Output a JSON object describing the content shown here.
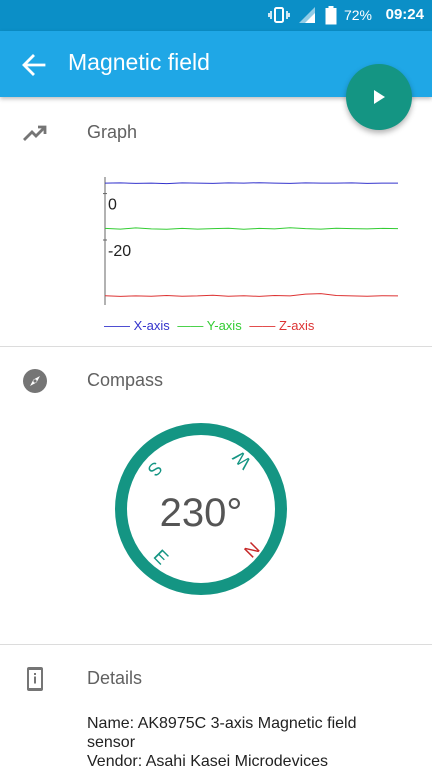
{
  "statusbar": {
    "battery": "72%",
    "time": "09:24"
  },
  "appbar": {
    "title": "Magnetic field"
  },
  "graph": {
    "title": "Graph"
  },
  "compass": {
    "title": "Compass",
    "heading": "230°",
    "labels": {
      "n": "N",
      "e": "E",
      "s": "S",
      "w": "W"
    }
  },
  "details": {
    "title": "Details",
    "name": "Name: AK8975C 3-axis Magnetic field sensor",
    "vendor": "Vendor: Asahi Kasei Microdevices"
  },
  "chart_data": {
    "type": "line",
    "yticks": [
      0,
      -20
    ],
    "ylim": [
      -48,
      8
    ],
    "legend_position": "bottom",
    "series": [
      {
        "name": "X-axis",
        "color": "#3333cc",
        "values": [
          4.5,
          4.6,
          4.4,
          4.5,
          4.3,
          4.6,
          4.5,
          4.4,
          4.6,
          4.5,
          4.7,
          4.5,
          4.4,
          4.6,
          4.5,
          4.5,
          4.6,
          4.4,
          4.5,
          4.5
        ]
      },
      {
        "name": "Y-axis",
        "color": "#33cc33",
        "values": [
          -15.0,
          -15.3,
          -14.8,
          -15.2,
          -15.4,
          -15.0,
          -15.3,
          -15.1,
          -14.9,
          -15.4,
          -15.0,
          -15.2,
          -14.7,
          -15.1,
          -15.3,
          -14.9,
          -15.1,
          -15.2,
          -15.0,
          -15.1
        ]
      },
      {
        "name": "Z-axis",
        "color": "#dd3333",
        "values": [
          -44.0,
          -44.3,
          -44.1,
          -44.2,
          -43.9,
          -44.2,
          -44.1,
          -43.8,
          -44.2,
          -44.0,
          -44.3,
          -43.9,
          -44.1,
          -43.3,
          -43.1,
          -43.9,
          -44.1,
          -44.2,
          -44.0,
          -44.1
        ]
      }
    ]
  }
}
